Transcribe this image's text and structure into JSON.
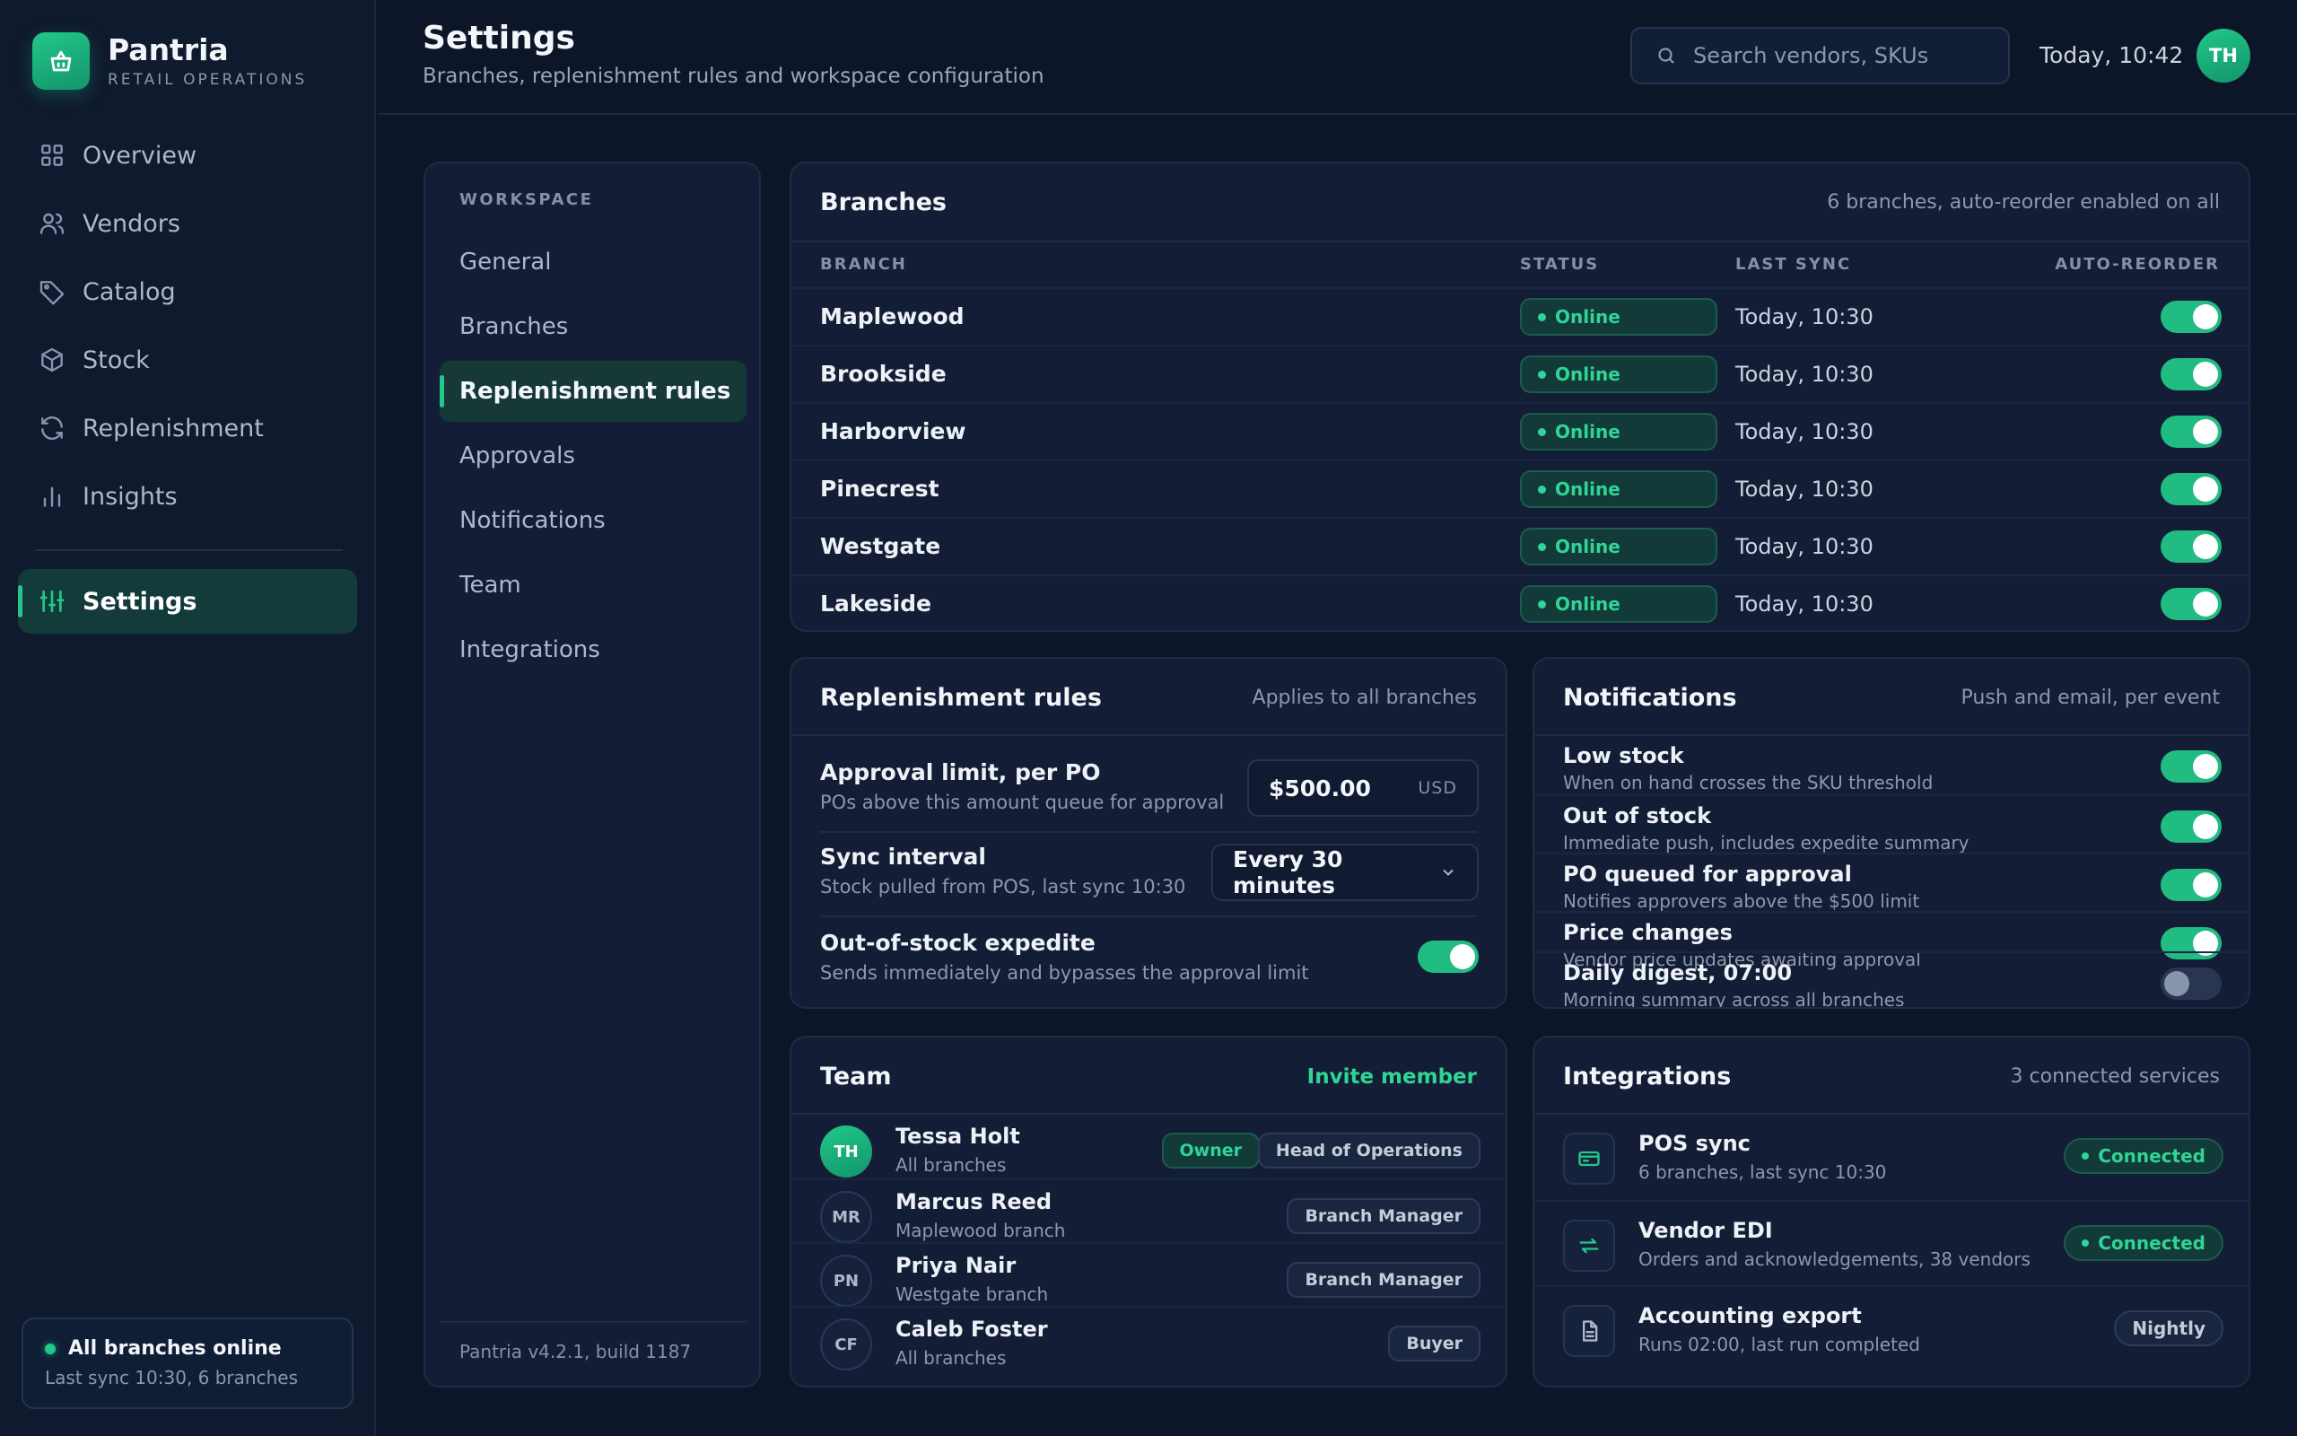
{
  "app": {
    "name": "Pantria",
    "subtitle": "RETAIL OPERATIONS"
  },
  "nav": {
    "items": [
      {
        "label": "Overview",
        "icon": "grid-icon"
      },
      {
        "label": "Vendors",
        "icon": "users-icon"
      },
      {
        "label": "Catalog",
        "icon": "tag-icon"
      },
      {
        "label": "Stock",
        "icon": "box-icon"
      },
      {
        "label": "Replenishment",
        "icon": "refresh-icon"
      },
      {
        "label": "Insights",
        "icon": "bar-chart-icon"
      }
    ],
    "active": {
      "label": "Settings",
      "icon": "sliders-icon"
    }
  },
  "side_status": {
    "title": "All branches online",
    "detail": "Last sync 10:30, 6 branches"
  },
  "header": {
    "title": "Settings",
    "subtitle": "Branches, replenishment rules and workspace configuration",
    "search_placeholder": "Search vendors, SKUs",
    "clock": "Today, 10:42",
    "user_initials": "TH"
  },
  "subnav": {
    "heading": "WORKSPACE",
    "items": [
      "General",
      "Branches",
      "Replenishment rules",
      "Approvals",
      "Notifications",
      "Team",
      "Integrations"
    ],
    "active": "Replenishment rules",
    "version": "Pantria v4.2.1, build 1187"
  },
  "branches": {
    "title": "Branches",
    "meta": "6 branches, auto-reorder enabled on all",
    "columns": [
      "BRANCH",
      "STATUS",
      "LAST SYNC",
      "AUTO-REORDER"
    ],
    "rows": [
      {
        "name": "Maplewood",
        "status": "Online",
        "last_sync": "Today, 10:30",
        "auto_reorder": true
      },
      {
        "name": "Brookside",
        "status": "Online",
        "last_sync": "Today, 10:30",
        "auto_reorder": true
      },
      {
        "name": "Harborview",
        "status": "Online",
        "last_sync": "Today, 10:30",
        "auto_reorder": true
      },
      {
        "name": "Pinecrest",
        "status": "Online",
        "last_sync": "Today, 10:30",
        "auto_reorder": true
      },
      {
        "name": "Westgate",
        "status": "Online",
        "last_sync": "Today, 10:30",
        "auto_reorder": true
      },
      {
        "name": "Lakeside",
        "status": "Online",
        "last_sync": "Today, 10:30",
        "auto_reorder": true
      }
    ]
  },
  "rules": {
    "title": "Replenishment rules",
    "meta": "Applies to all branches",
    "approval": {
      "label": "Approval limit, per PO",
      "desc": "POs above this amount queue for approval",
      "value": "$500.00",
      "unit": "USD"
    },
    "sync": {
      "label": "Sync interval",
      "desc": "Stock pulled from POS, last sync 10:30",
      "value": "Every 30 minutes"
    },
    "expedite": {
      "label": "Out-of-stock expedite",
      "desc": "Sends immediately and bypasses the approval limit",
      "enabled": true
    }
  },
  "notifications": {
    "title": "Notifications",
    "meta": "Push and email, per event",
    "rows": [
      {
        "label": "Low stock",
        "desc": "When on hand crosses the SKU threshold",
        "enabled": true
      },
      {
        "label": "Out of stock",
        "desc": "Immediate push, includes expedite summary",
        "enabled": true
      },
      {
        "label": "PO queued for approval",
        "desc": "Notifies approvers above the $500 limit",
        "enabled": true
      },
      {
        "label": "Price changes",
        "desc": "Vendor price updates awaiting approval",
        "enabled": true
      },
      {
        "label": "Daily digest, 07:00",
        "desc": "Morning summary across all branches",
        "enabled": false
      }
    ]
  },
  "team": {
    "title": "Team",
    "action": "Invite member",
    "members": [
      {
        "initials": "TH",
        "name": "Tessa Holt",
        "scope": "All branches",
        "badges": [
          "Owner",
          "Head of Operations"
        ]
      },
      {
        "initials": "MR",
        "name": "Marcus Reed",
        "scope": "Maplewood branch",
        "badges": [
          "Branch Manager"
        ]
      },
      {
        "initials": "PN",
        "name": "Priya Nair",
        "scope": "Westgate branch",
        "badges": [
          "Branch Manager"
        ]
      },
      {
        "initials": "CF",
        "name": "Caleb Foster",
        "scope": "All branches",
        "badges": [
          "Buyer"
        ]
      }
    ]
  },
  "integrations": {
    "title": "Integrations",
    "meta": "3 connected services",
    "rows": [
      {
        "name": "POS sync",
        "desc": "6 branches, last sync 10:30",
        "status": "Connected",
        "icon": "card-icon"
      },
      {
        "name": "Vendor EDI",
        "desc": "Orders and acknowledgements, 38 vendors",
        "status": "Connected",
        "icon": "swap-icon"
      },
      {
        "name": "Accounting export",
        "desc": "Runs 02:00, last run completed",
        "status": "Nightly",
        "icon": "file-icon"
      }
    ]
  },
  "colors": {
    "accent": "#22c78a",
    "background": "#0d1628",
    "panel": "#131e36"
  }
}
